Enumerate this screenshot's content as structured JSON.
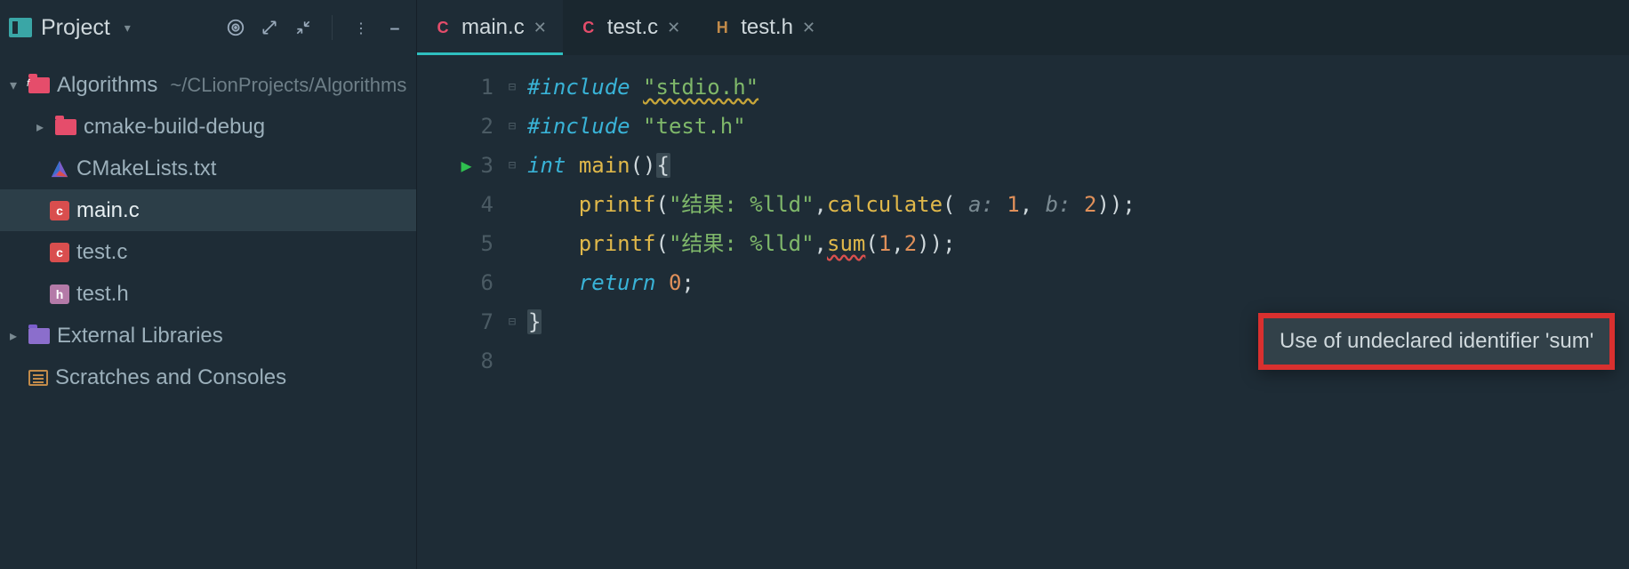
{
  "sidebar": {
    "title": "Project",
    "root": {
      "name": "Algorithms",
      "path": "~/CLionProjects/Algorithms"
    },
    "items": [
      {
        "label": "cmake-build-debug"
      },
      {
        "label": "CMakeLists.txt"
      },
      {
        "label": "main.c"
      },
      {
        "label": "test.c"
      },
      {
        "label": "test.h"
      }
    ],
    "external": "External Libraries",
    "scratches": "Scratches and Consoles"
  },
  "tabs": [
    {
      "label": "main.c",
      "icon": "c",
      "active": true
    },
    {
      "label": "test.c",
      "icon": "c",
      "active": false
    },
    {
      "label": "test.h",
      "icon": "h",
      "active": false
    }
  ],
  "code": {
    "l1a": "#include ",
    "l1b": "\"stdio.h\"",
    "l2a": "#include ",
    "l2b": "\"test.h\"",
    "l3a": "int",
    "l3b": " ",
    "l3c": "main",
    "l3d": "()",
    "l3e": "{",
    "l4a": "printf",
    "l4b": "(",
    "l4c": "\"结果: %lld\"",
    "l4d": ",",
    "l4e": "calculate",
    "l4f": "(",
    "l4p1": " a: ",
    "l4n1": "1",
    "l4d2": ",",
    "l4p2": " b: ",
    "l4n2": "2",
    "l4g": "));",
    "l5a": "printf",
    "l5b": "(",
    "l5c": "\"结果: %lld\"",
    "l5d": ",",
    "l5e": "sum",
    "l5f": "(",
    "l5n1": "1",
    "l5d2": ",",
    "l5n2": "2",
    "l5g": "));",
    "l6a": "return ",
    "l6b": "0",
    "l6c": ";",
    "l7a": "}"
  },
  "gutter": [
    "1",
    "2",
    "3",
    "4",
    "5",
    "6",
    "7",
    "8"
  ],
  "tooltip": "Use of undeclared identifier 'sum'"
}
